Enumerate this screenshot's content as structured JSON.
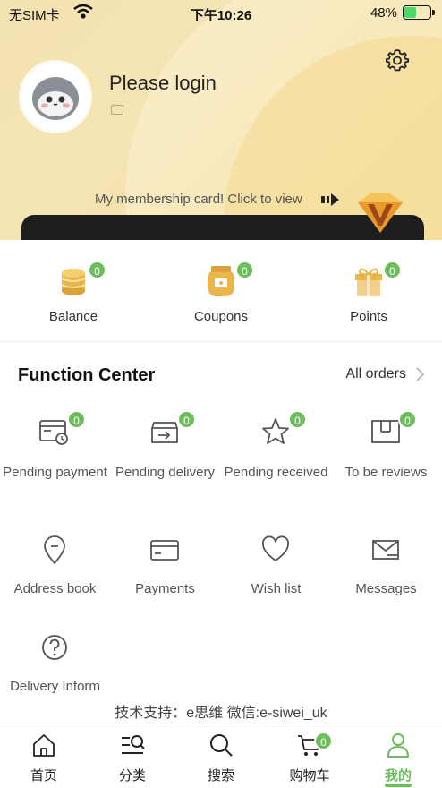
{
  "status_bar": {
    "carrier": "无SIM卡",
    "time": "下午10:26",
    "battery": "48%",
    "battery_level": 0.48
  },
  "profile": {
    "login_text": "Please login",
    "membership_text": "My membership card! Click to view"
  },
  "stats": [
    {
      "label": "Balance",
      "count": "0",
      "icon": "coins-stack-icon"
    },
    {
      "label": "Coupons",
      "count": "0",
      "icon": "coupon-jar-icon"
    },
    {
      "label": "Points",
      "count": "0",
      "icon": "gift-box-icon"
    }
  ],
  "function_center": {
    "title": "Function Center",
    "all_orders": "All orders",
    "items": [
      {
        "label": "Pending payment",
        "count": "0",
        "icon": "card-clock-icon"
      },
      {
        "label": "Pending delivery",
        "count": "0",
        "icon": "box-arrow-icon"
      },
      {
        "label": "Pending received",
        "count": "0",
        "icon": "star-icon"
      },
      {
        "label": "To be reviews",
        "count": "0",
        "icon": "package-icon"
      },
      {
        "label": "Address book",
        "icon": "location-pin-icon"
      },
      {
        "label": "Payments",
        "icon": "credit-card-icon"
      },
      {
        "label": "Wish list",
        "icon": "heart-icon"
      },
      {
        "label": "Messages",
        "icon": "envelope-icon"
      },
      {
        "label": "Delivery Inform",
        "icon": "question-circle-icon"
      }
    ]
  },
  "support_text": "技术支持：e思维 微信:e-siwei_uk",
  "tabs": [
    {
      "label": "首页",
      "icon": "home-icon"
    },
    {
      "label": "分类",
      "icon": "category-search-icon"
    },
    {
      "label": "搜索",
      "icon": "search-icon"
    },
    {
      "label": "购物车",
      "icon": "cart-icon",
      "count": "0"
    },
    {
      "label": "我的",
      "icon": "user-icon",
      "active": true
    }
  ],
  "colors": {
    "accent": "#6dbd5c",
    "header_gold": "#f0d98f",
    "coin_gold": "#e8b64a"
  }
}
